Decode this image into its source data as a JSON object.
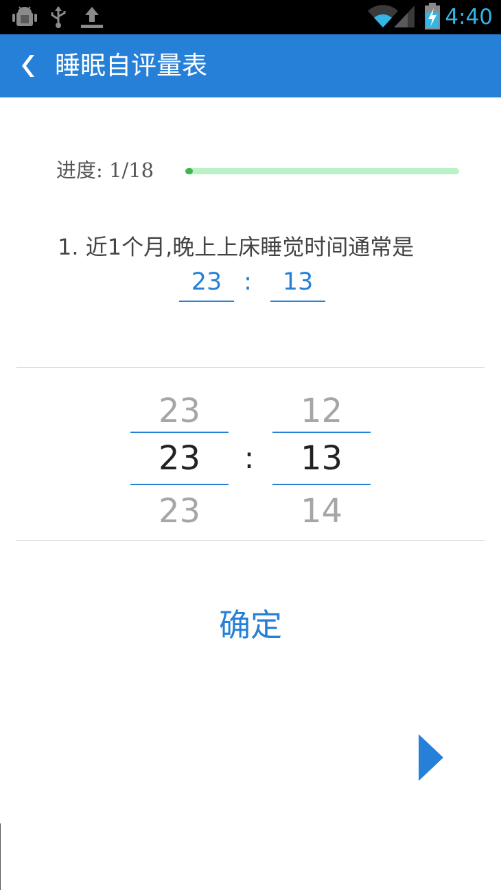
{
  "status_bar": {
    "time": "4:40",
    "icons": [
      "android-debug-icon",
      "usb-icon",
      "upload-icon",
      "wifi-icon",
      "signal-icon",
      "battery-charging-icon"
    ],
    "time_color": "#33b5e5"
  },
  "app_bar": {
    "title": "睡眠自评量表",
    "back_icon": "chevron-left-icon",
    "color": "#2680d8"
  },
  "progress": {
    "label": "进度: 1/18",
    "current": 1,
    "total": 18,
    "fill_color": "#3db84d",
    "track_color": "#b9f2c6"
  },
  "question": {
    "text": "1. 近1个月,晚上上床睡觉时间通常是",
    "answer_hour": "23",
    "answer_separator": ":",
    "answer_minute": "13"
  },
  "picker": {
    "hour": {
      "prev": "23",
      "selected": "23",
      "next": "23"
    },
    "minute": {
      "prev": "12",
      "selected": "13",
      "next": "14"
    },
    "separator": ":"
  },
  "actions": {
    "confirm_label": "确定",
    "next_icon": "next-arrow-icon"
  }
}
